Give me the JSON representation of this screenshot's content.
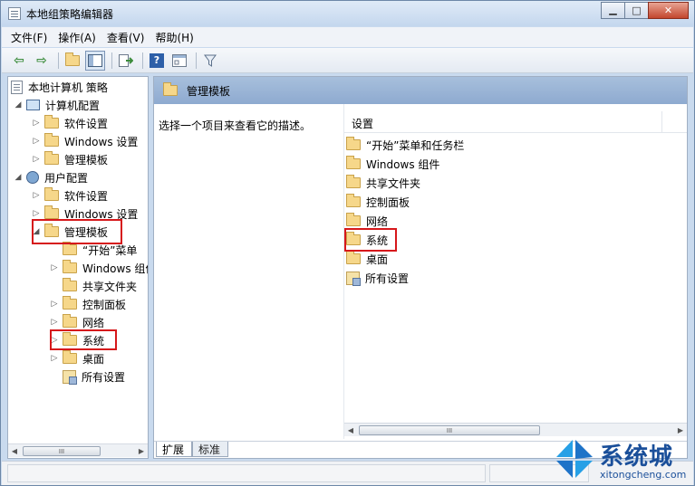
{
  "window": {
    "title": "本地组策略编辑器",
    "minimize_label": "▁",
    "maximize_label": "□",
    "close_label": "✕"
  },
  "menu": [
    {
      "label": "文件(F)"
    },
    {
      "label": "操作(A)"
    },
    {
      "label": "查看(V)"
    },
    {
      "label": "帮助(H)"
    }
  ],
  "toolbar": {
    "back_glyph": "⇦",
    "forward_glyph": "⇨",
    "help_glyph": "?",
    "filter_glyph": "▼",
    "icons": [
      "back-arrow-icon",
      "forward-arrow-icon",
      "up-folder-icon",
      "show-hide-tree-icon",
      "export-list-icon",
      "help-icon",
      "properties-icon",
      "filter-icon"
    ]
  },
  "tree": {
    "root": "本地计算机 策略",
    "computer_config": "计算机配置",
    "user_config": "用户配置",
    "items": {
      "cc_software": "软件设置",
      "cc_windows": "Windows 设置",
      "cc_admin": "管理模板",
      "uc_software": "软件设置",
      "uc_windows": "Windows 设置",
      "uc_admin": "管理模板",
      "uc_start": "“开始”菜单",
      "uc_wincomp": "Windows 组件",
      "uc_shared": "共享文件夹",
      "uc_control": "控制面板",
      "uc_network": "网络",
      "uc_system": "系统",
      "uc_desktop": "桌面",
      "uc_all": "所有设置"
    },
    "scroll_grip": "III"
  },
  "right": {
    "header_title": "管理模板",
    "description": "选择一个项目来查看它的描述。",
    "column_header": "设置",
    "items": [
      "“开始”菜单和任务栏",
      "Windows 组件",
      "共享文件夹",
      "控制面板",
      "网络",
      "系统",
      "桌面",
      "所有设置"
    ],
    "scroll_grip": "III"
  },
  "tabs": [
    {
      "label": "扩展"
    },
    {
      "label": "标准"
    }
  ],
  "watermark": {
    "text": "系统城",
    "url": "xitongcheng.com"
  }
}
